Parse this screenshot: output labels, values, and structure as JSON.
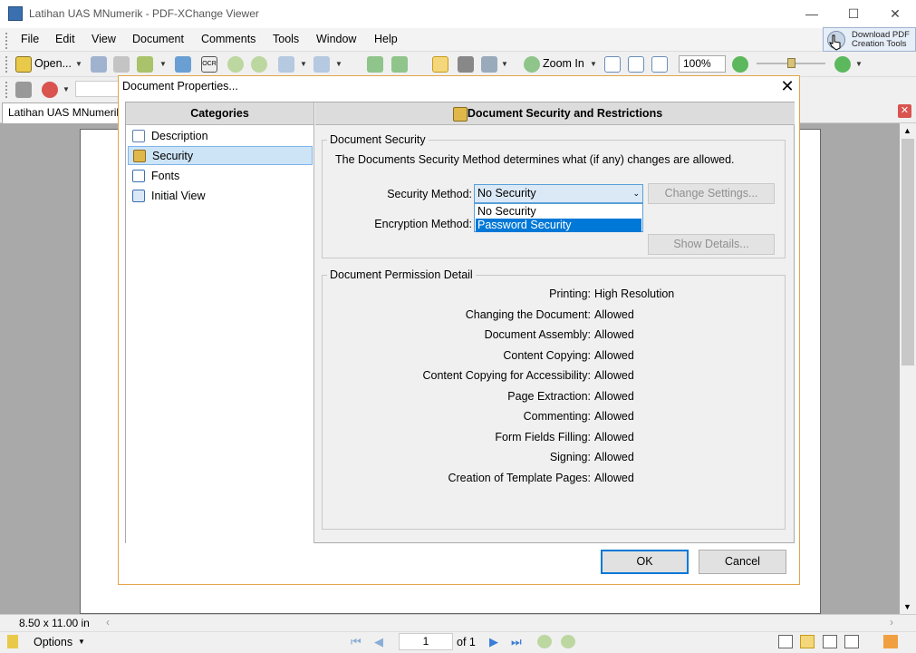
{
  "window": {
    "title": "Latihan UAS MNumerik - PDF-XChange Viewer"
  },
  "menubar": [
    "File",
    "Edit",
    "View",
    "Document",
    "Comments",
    "Tools",
    "Window",
    "Help"
  ],
  "download_btn": {
    "line1": "Download PDF",
    "line2": "Creation Tools"
  },
  "toolbar": {
    "open_label": "Open...",
    "ocr_label": "OCR",
    "zoom_in_label": "Zoom In",
    "zoom_value": "100%"
  },
  "doc_tab": {
    "label": "Latihan UAS MNumerik"
  },
  "dialog": {
    "title": "Document Properties...",
    "categories_header": "Categories",
    "categories": [
      "Description",
      "Security",
      "Fonts",
      "Initial View"
    ],
    "section_header": "Document Security and Restrictions",
    "security_group": {
      "label": "Document Security",
      "intro": "The Documents Security Method determines what (if any) changes are allowed.",
      "method_label": "Security Method:",
      "method_value": "No Security",
      "method_options": [
        "No Security",
        "Password Security"
      ],
      "encryption_label": "Encryption Method:",
      "change_settings": "Change Settings...",
      "show_details": "Show Details..."
    },
    "permission_group": {
      "label": "Document Permission Detail",
      "rows": [
        {
          "label": "Printing:",
          "value": "High Resolution"
        },
        {
          "label": "Changing the Document:",
          "value": "Allowed"
        },
        {
          "label": "Document Assembly:",
          "value": "Allowed"
        },
        {
          "label": "Content Copying:",
          "value": "Allowed"
        },
        {
          "label": "Content Copying for Accessibility:",
          "value": "Allowed"
        },
        {
          "label": "Page Extraction:",
          "value": "Allowed"
        },
        {
          "label": "Commenting:",
          "value": "Allowed"
        },
        {
          "label": "Form Fields Filling:",
          "value": "Allowed"
        },
        {
          "label": "Signing:",
          "value": "Allowed"
        },
        {
          "label": "Creation of Template Pages:",
          "value": "Allowed"
        }
      ]
    },
    "ok": "OK",
    "cancel": "Cancel"
  },
  "status": {
    "page_size": "8.50 x 11.00 in",
    "options": "Options",
    "page_current": "1",
    "page_total": "of 1"
  }
}
